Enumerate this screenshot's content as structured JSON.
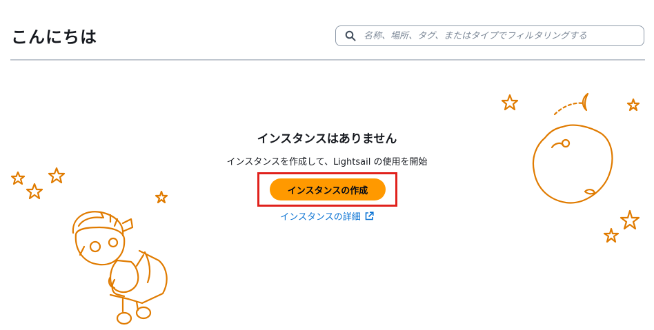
{
  "header": {
    "title": "こんにちは",
    "search": {
      "placeholder": "名称、場所、タグ、またはタイプでフィルタリングする",
      "value": ""
    }
  },
  "empty_state": {
    "heading": "インスタンスはありません",
    "description": "インスタンスを作成して、Lightsail の使用を開始",
    "create_button_label": "インスタンスの作成",
    "details_link_label": "インスタンスの詳細"
  },
  "colors": {
    "accent": "#ff9900",
    "link": "#0972d3",
    "highlight": "#e0211c",
    "illustration": "#e07b00"
  },
  "icons": {
    "search": "search-icon",
    "external": "external-link-icon"
  }
}
